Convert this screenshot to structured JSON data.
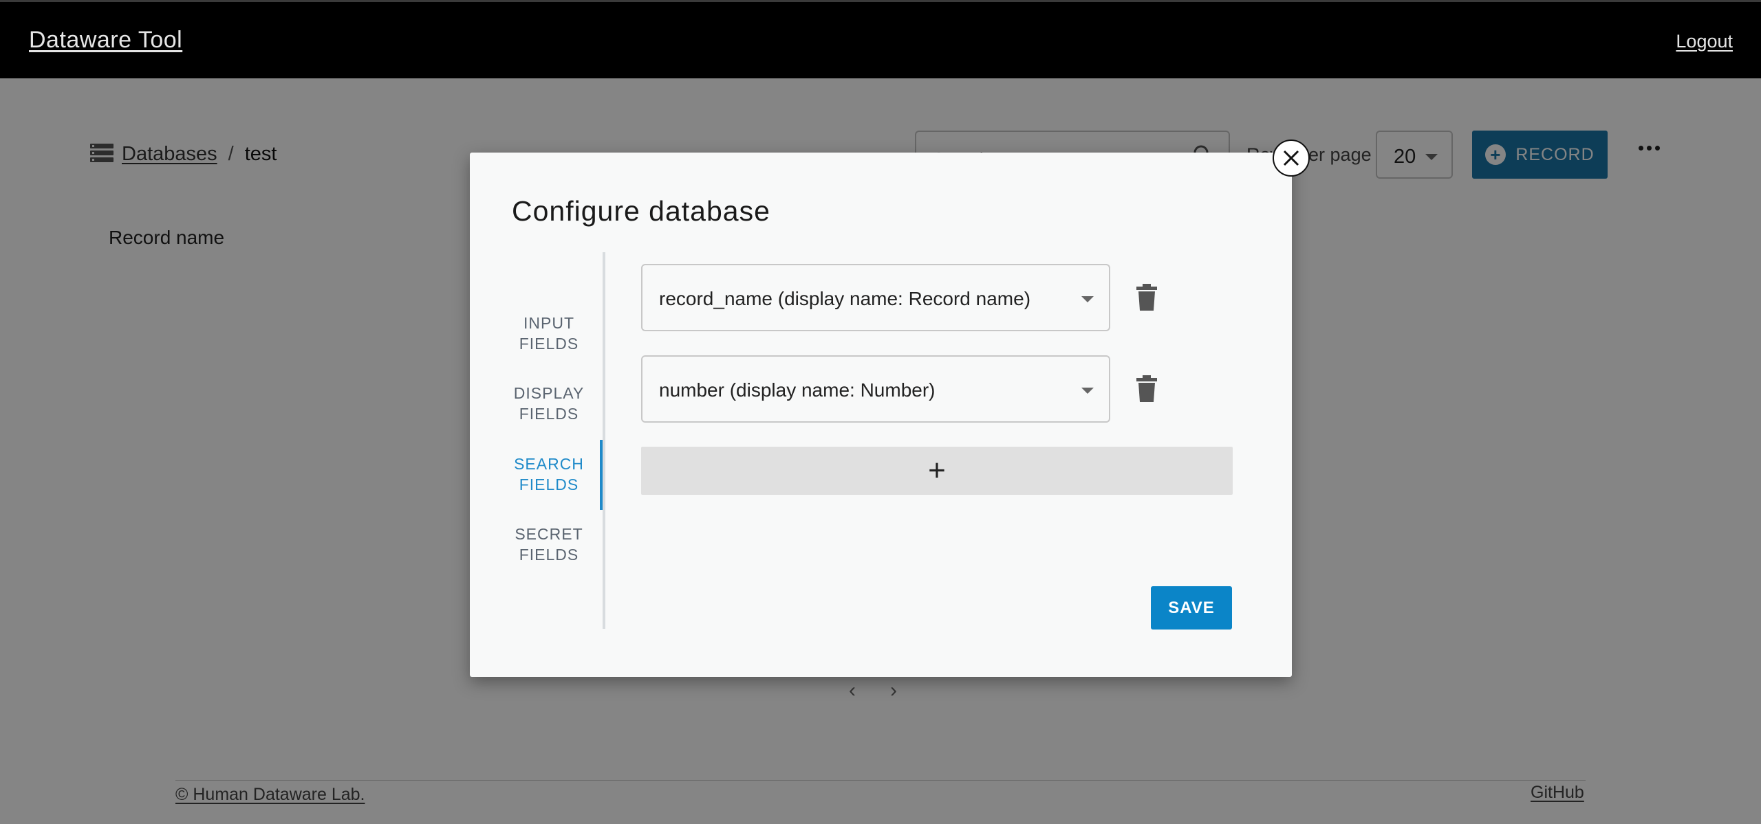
{
  "app": {
    "title": "Dataware Tool",
    "logout_label": "Logout"
  },
  "breadcrumb": {
    "icon": "database-list-icon",
    "link_label": "Databases",
    "separator": "/",
    "current": "test"
  },
  "toolbar": {
    "search_placeholder": "Search",
    "rows_per_page_label": "Rows per page",
    "rows_per_page_value": "20",
    "add_record_label": "RECORD",
    "more_icon": "more-horizontal-icon"
  },
  "table": {
    "column_headers": [
      "Record name"
    ]
  },
  "footer": {
    "copyright": "© Human Dataware Lab.",
    "github_label": "GitHub"
  },
  "modal": {
    "title": "Configure database",
    "tabs": [
      {
        "line1": "INPUT",
        "line2": "FIELDS",
        "active": false
      },
      {
        "line1": "DISPLAY",
        "line2": "FIELDS",
        "active": false
      },
      {
        "line1": "SEARCH",
        "line2": "FIELDS",
        "active": true
      },
      {
        "line1": "SECRET",
        "line2": "FIELDS",
        "active": false
      }
    ],
    "fields": [
      {
        "value": "record_name (display name: Record name)"
      },
      {
        "value": "number (display name: Number)"
      }
    ],
    "add_field_label": "+",
    "save_label": "SAVE"
  },
  "colors": {
    "header_bg": "#000000",
    "accent": "#1f8ac9",
    "save_bg": "#0b85c8",
    "record_btn_bg": "#1976a8"
  }
}
